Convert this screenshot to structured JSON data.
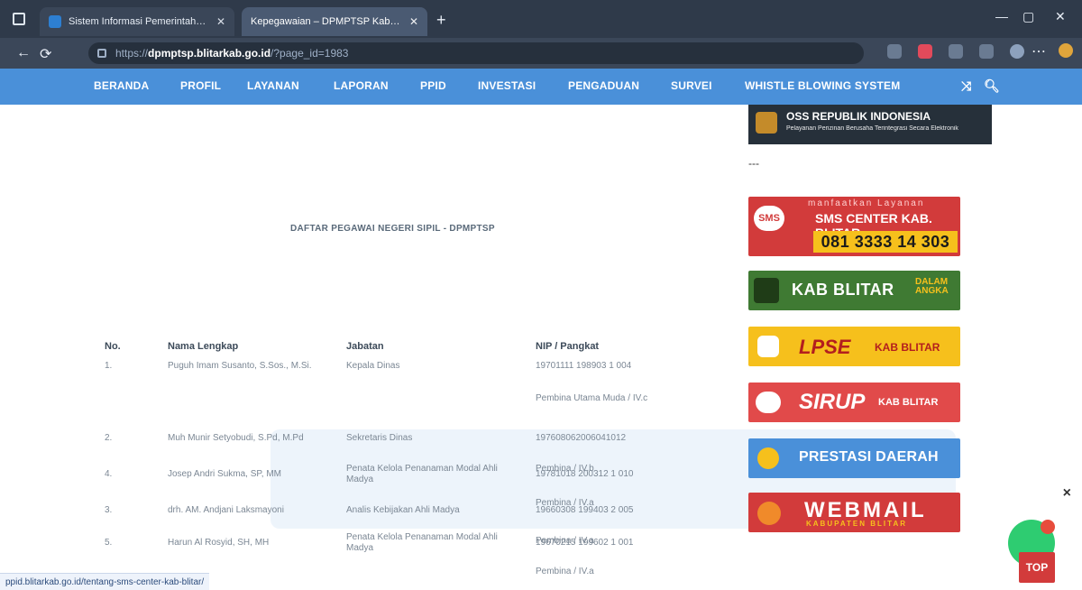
{
  "browser": {
    "tabs": [
      {
        "title": "Sistem Informasi Pemerintahan D",
        "state": "inactive"
      },
      {
        "title": "Kepegawaian – DPMPTSP Kabupa",
        "state": "active"
      }
    ],
    "address": {
      "scheme": "https://",
      "host": "dpmptsp.blitarkab.go.id",
      "path": "/?page_id=1983"
    },
    "window_controls": {
      "min": "—",
      "max": "▢",
      "close": "✕"
    },
    "status_url": "ppid.blitarkab.go.id/tentang-sms-center-kab-blitar/"
  },
  "site_nav": {
    "items": [
      "BERANDA",
      "PROFIL",
      "LAYANAN",
      "LAPORAN",
      "PPID",
      "INVESTASI",
      "PENGADUAN",
      "SURVEI",
      "WHISTLE BLOWING SYSTEM"
    ],
    "icons": [
      "shuffle-icon",
      "search-icon"
    ]
  },
  "main": {
    "table_title": "DAFTAR PEGAWAI NEGERI SIPIL - DPMPTSP",
    "columns": [
      "No.",
      "Nama Lengkap",
      "Jabatan",
      "NIP / Pangkat"
    ],
    "rows": [
      {
        "no": "1.",
        "nama": "Puguh Imam Susanto, S.Sos., M.Si.",
        "jabatan": "Kepala Dinas",
        "nip": "19701111 198903 1 004",
        "pangkat": "Pembina Utama Muda / IV.c"
      },
      {
        "no": "2.",
        "nama": "Muh Munir Setyobudi, S.Pd, M.Pd",
        "jabatan": "Sekretaris Dinas",
        "nip": "197608062006041012",
        "pangkat": "Pembina / IV.b"
      },
      {
        "no": "3.",
        "nama": "drh. AM. Andjani Laksmayoni",
        "jabatan": "Analis Kebijakan Ahli Madya",
        "nip": "19660308 199403 2 005",
        "pangkat": "Pembina / IV.a"
      },
      {
        "no": "4.",
        "nama": "Josep Andri Sukma, SP, MM",
        "jabatan": "Penata Kelola Penanaman Modal Ahli Madya",
        "nip": "19781018 200312 1 010",
        "pangkat": "Pembina / IV.a"
      },
      {
        "no": "5.",
        "nama": "Harun Al Rosyid, SH, MH",
        "jabatan": "Penata Kelola Penanaman Modal Ahli Madya",
        "nip": "19670215 199602 1 001",
        "pangkat": "Pembina / IV.a"
      }
    ]
  },
  "sidebar": {
    "oss": {
      "title": "OSS REPUBLIK INDONESIA",
      "subtitle": "Pelayanan Perizinan Berusaha Terintegrasi Secara Elektronik"
    },
    "dash": "---",
    "banners": {
      "sms": {
        "line1": "manfaatkan Layanan",
        "line2": "SMS CENTER KAB. BLITAR",
        "number": "081 3333 14 303",
        "icon_text": "SMS"
      },
      "kab": {
        "title": "KAB BLITAR",
        "subtitle": "DALAM ANGKA"
      },
      "lpse": {
        "title": "LPSE",
        "subtitle": "KAB BLITAR"
      },
      "sirup": {
        "title": "SIRUP",
        "subtitle": "KAB BLITAR"
      },
      "prestasi": {
        "title": "PRESTASI DAERAH"
      },
      "webmail": {
        "title": "WEBMAIL",
        "subtitle": "KABUPATEN BLITAR"
      }
    }
  },
  "widgets": {
    "top_button": "TOP",
    "chat_close": "×"
  }
}
